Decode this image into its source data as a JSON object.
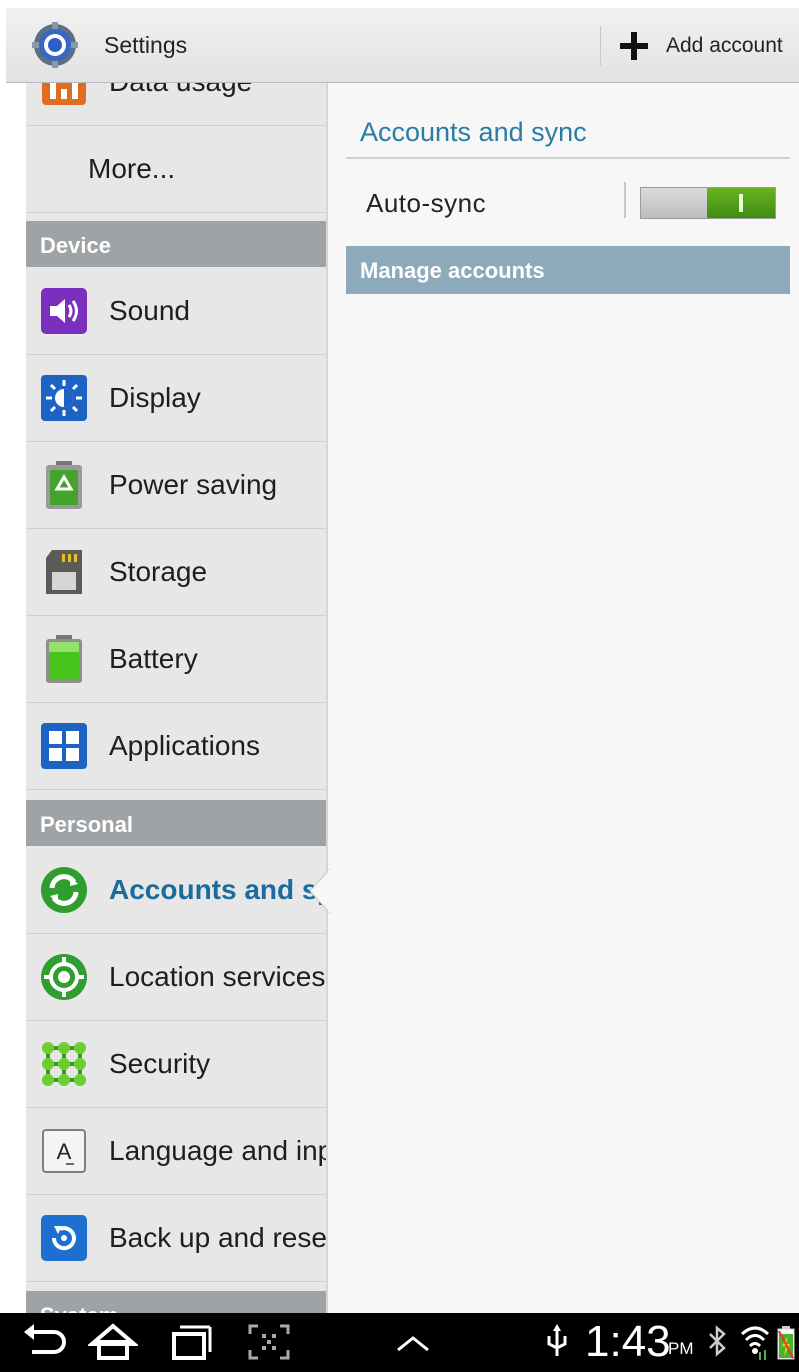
{
  "action_bar": {
    "title": "Settings",
    "add_account_label": "Add account"
  },
  "left_pane": {
    "data_usage_label": "Data usage",
    "more_label": "More...",
    "device_header": "Device",
    "device_items": [
      "Sound",
      "Display",
      "Power saving",
      "Storage",
      "Battery",
      "Applications"
    ],
    "personal_header": "Personal",
    "personal_items": [
      "Accounts and sync",
      "Location services",
      "Security",
      "Language and input",
      "Back up and reset"
    ],
    "system_header": "System",
    "selected": "Accounts and sync"
  },
  "right_pane": {
    "title": "Accounts and sync",
    "auto_sync_label": "Auto-sync",
    "auto_sync_on": true,
    "manage_accounts_header": "Manage accounts"
  },
  "system_bar": {
    "time": "1:43",
    "ampm": "PM",
    "icons": [
      "back-icon",
      "home-icon",
      "recent-apps-icon",
      "screenshot-icon",
      "up-arrow-icon",
      "usb-icon",
      "bluetooth-icon",
      "wifi-icon",
      "battery-icon"
    ]
  },
  "colors": {
    "accent": "#2a7ca4",
    "active_item": "#1c6b9e",
    "toggle_on": "#4d9d18",
    "section_header": "#9fa3a6",
    "manage_header": "#8daabb"
  }
}
